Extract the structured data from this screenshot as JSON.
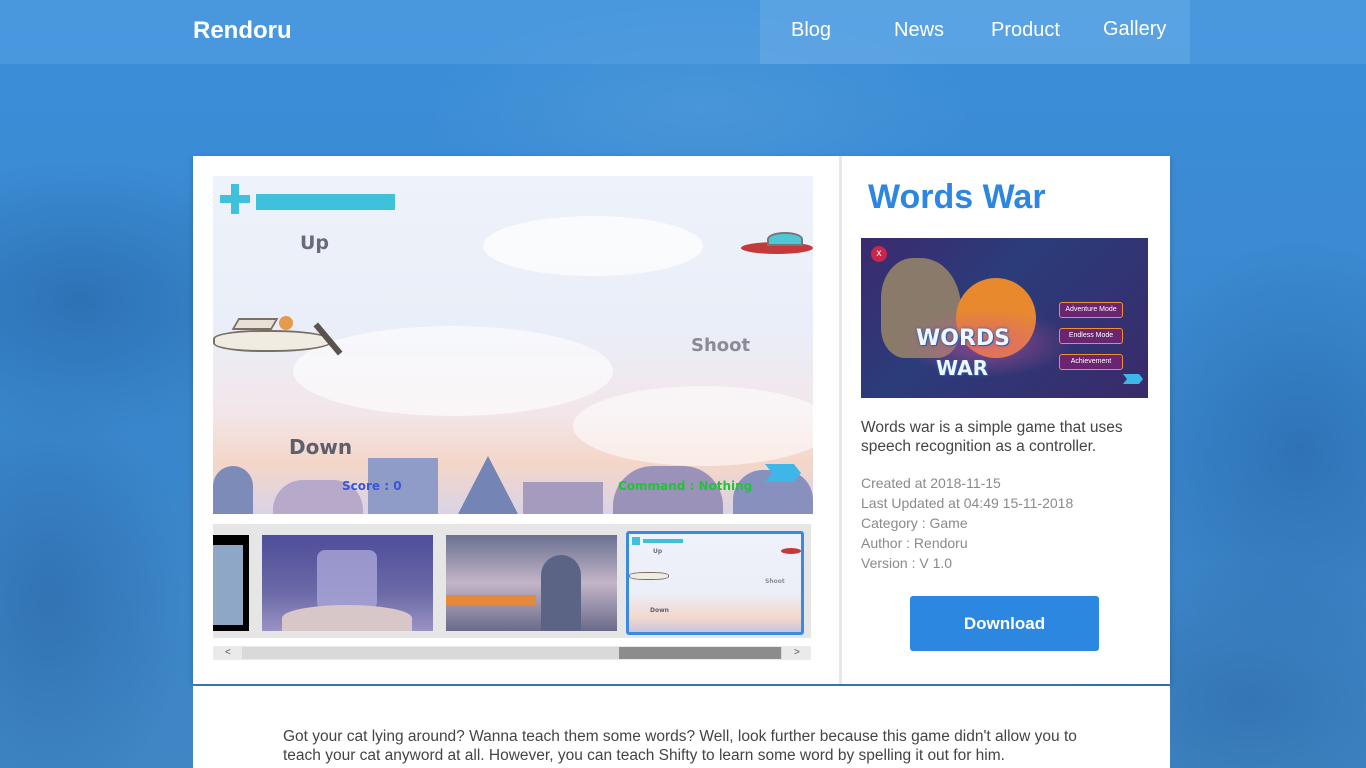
{
  "header": {
    "brand": "Rendoru",
    "nav": [
      "Blog",
      "News",
      "Product",
      "Gallery"
    ]
  },
  "game": {
    "title": "Words War",
    "description": "Words war is a simple game that uses speech recognition as a controller.",
    "meta": {
      "created": "Created at 2018-11-15",
      "updated": "Last Updated at 04:49 15-11-2018",
      "category": "Category : Game",
      "author": "Author : Rendoru",
      "version": "Version : V 1.0"
    },
    "download_label": "Download"
  },
  "screenshot": {
    "up": "Up",
    "down": "Down",
    "shoot": "Shoot",
    "score": "Score : 0",
    "command": "Command : Nothing"
  },
  "cover": {
    "close": "x",
    "logo_line1": "WORDS",
    "logo_line2": "WAR",
    "menu": [
      "Adventure Mode",
      "Endless Mode",
      "Achievement"
    ]
  },
  "thumb_mini": {
    "up": "Up",
    "shoot": "Shoot",
    "down": "Down"
  },
  "scroll": {
    "left": "<",
    "right": ">"
  },
  "article": {
    "text": "Got your cat lying around? Wanna teach them some words? Well, look further because this game didn't allow you to teach your cat anyword at all. However, you can teach Shifty to learn some word by spelling it out for him."
  },
  "colors": {
    "accent": "#2b87df",
    "title": "#2d86df",
    "health_bar": "#3fc1dc",
    "background": "#3a8fd9"
  }
}
